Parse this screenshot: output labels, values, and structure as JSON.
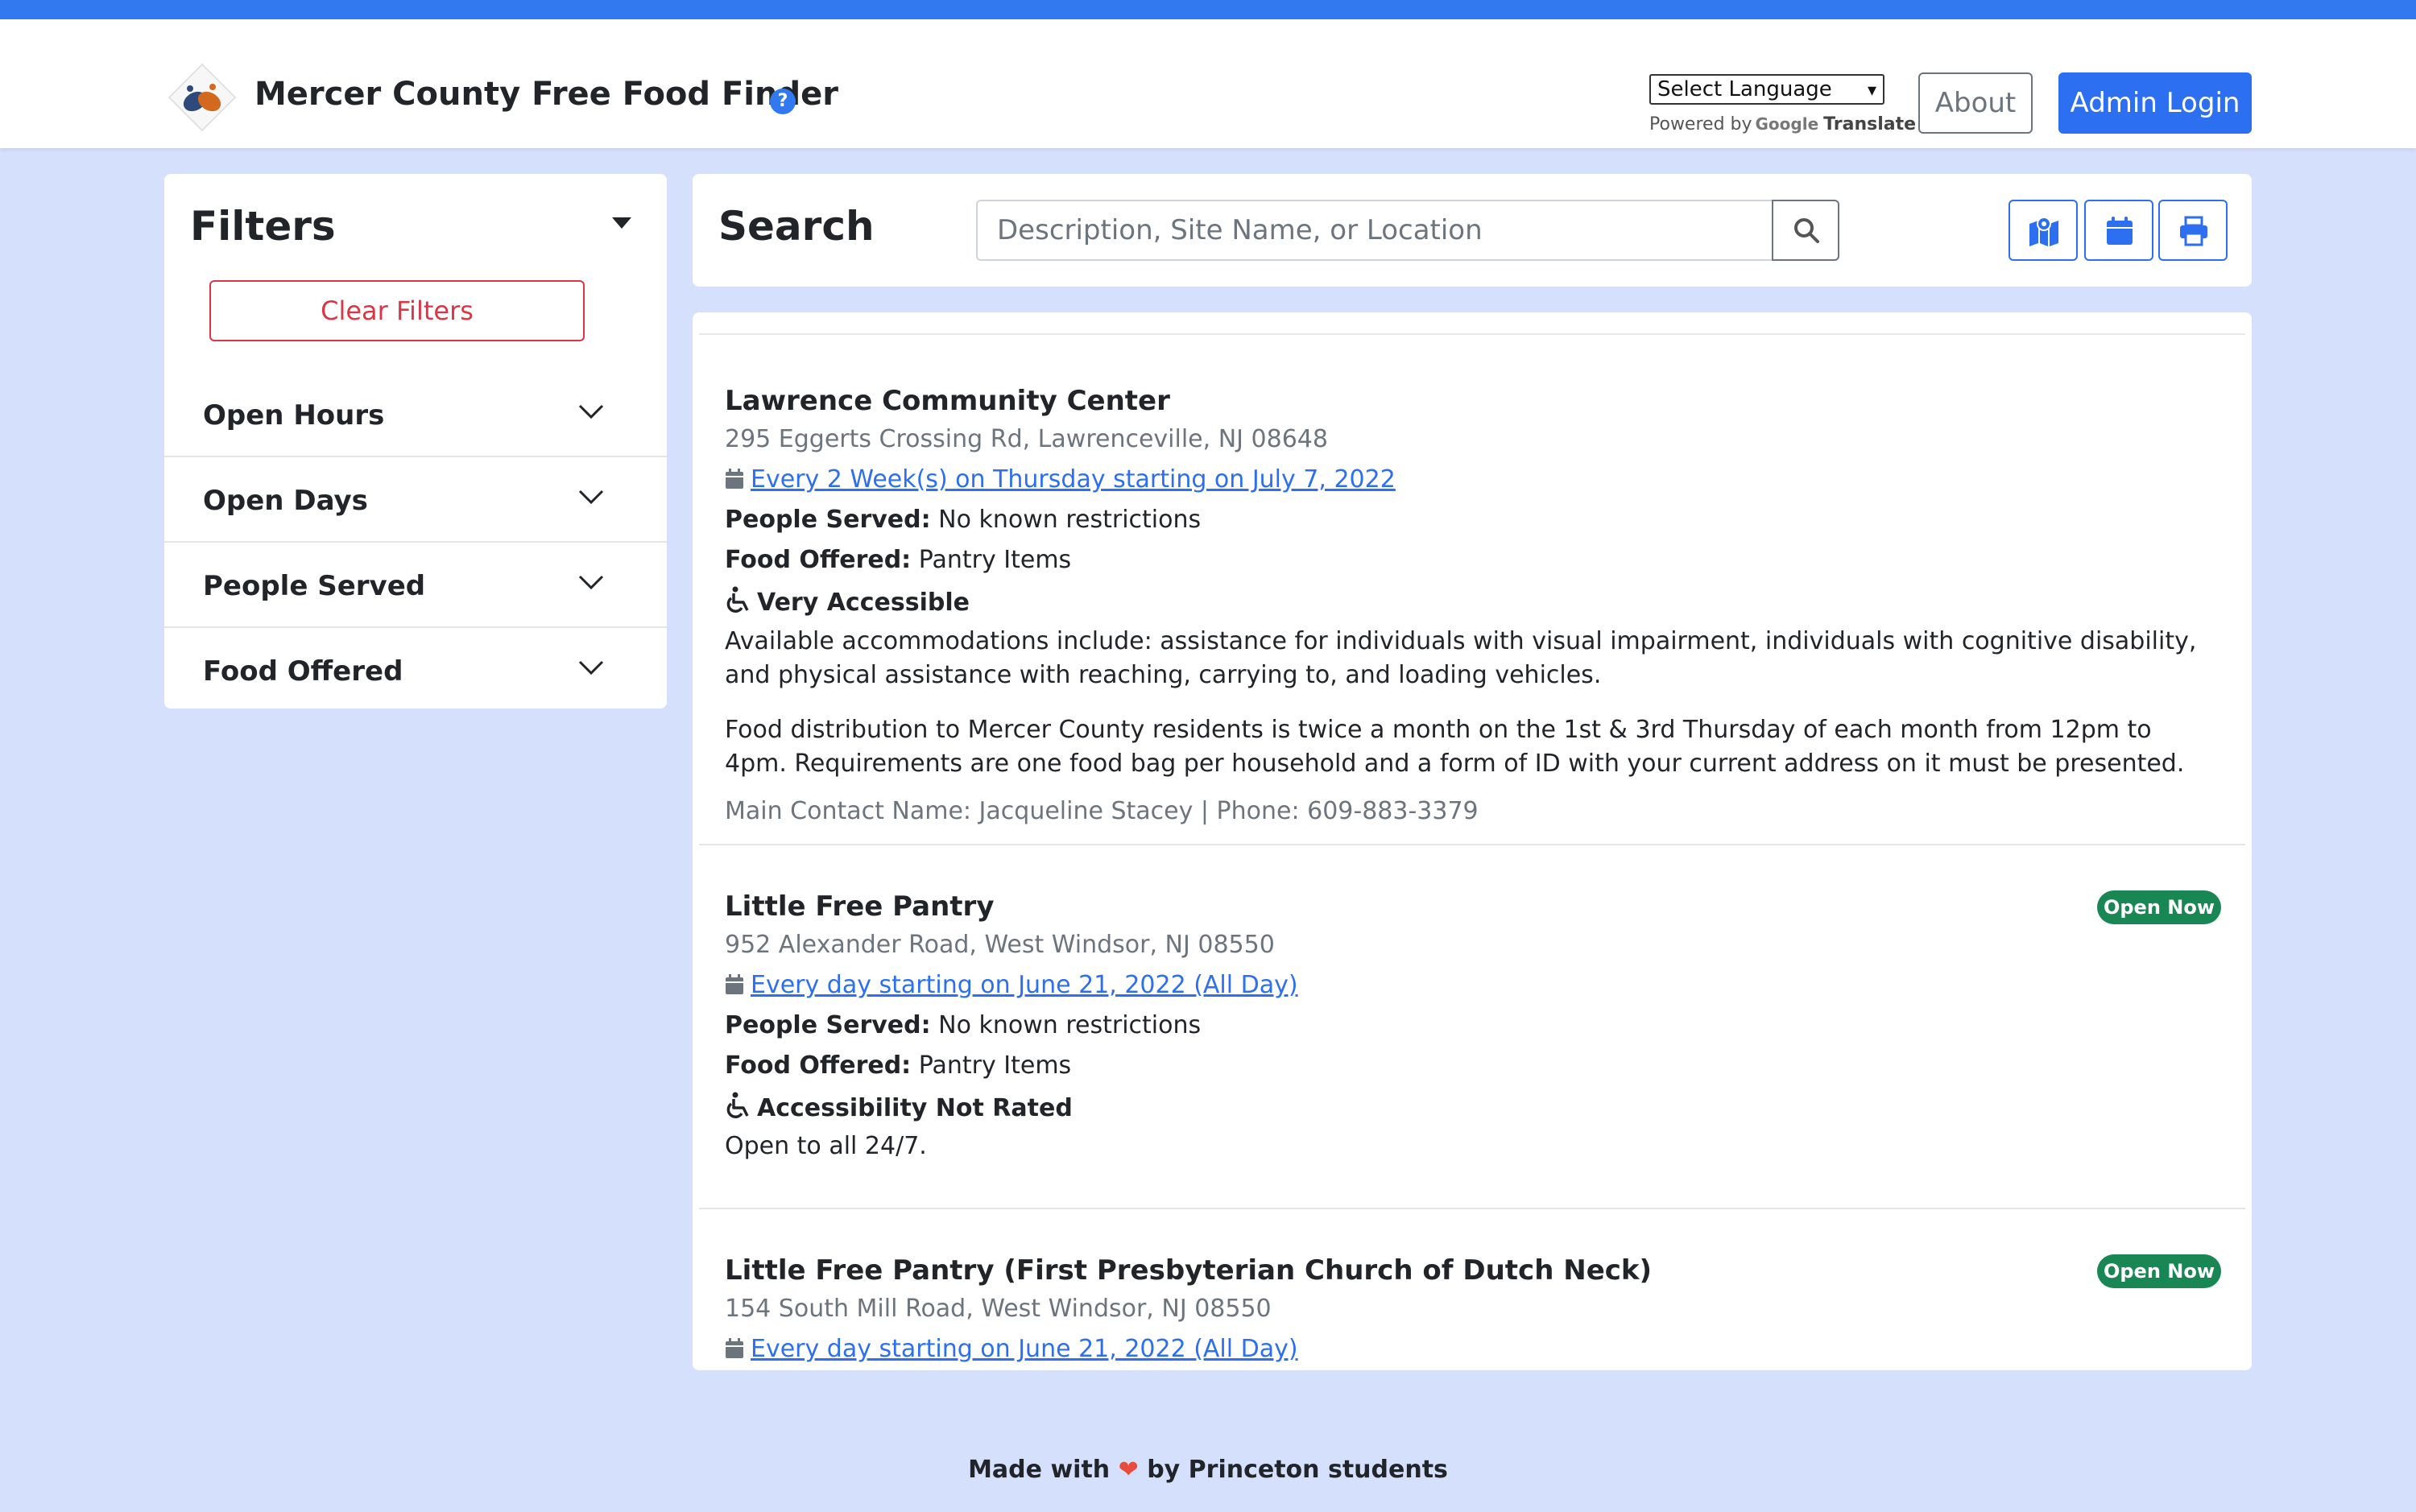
{
  "header": {
    "app_title": "Mercer County Free Food Finder",
    "help_icon": "?",
    "language_select": "Select Language",
    "powered_by": "Powered by",
    "google": "Google",
    "translate": "Translate",
    "about_label": "About",
    "admin_login_label": "Admin Login"
  },
  "filters": {
    "title": "Filters",
    "clear_label": "Clear Filters",
    "items": [
      {
        "label": "Open Hours"
      },
      {
        "label": "Open Days"
      },
      {
        "label": "People Served"
      },
      {
        "label": "Food Offered"
      }
    ]
  },
  "search": {
    "title": "Search",
    "placeholder": "Description, Site Name, or Location",
    "icons": [
      "map-icon",
      "calendar-icon",
      "print-icon"
    ]
  },
  "results": [
    {
      "name": "Lawrence Community Center",
      "address": "295 Eggerts Crossing Rd, Lawrenceville, NJ 08648",
      "schedule": "Every 2 Week(s) on Thursday starting on July 7, 2022",
      "people_label": "People Served:",
      "people_value": "No known restrictions",
      "food_label": "Food Offered:",
      "food_value": "Pantry Items",
      "accessibility": "Very Accessible",
      "accommodations": "Available accommodations include: assistance for individuals with visual impairment, individuals with cognitive disability, and physical assistance with reaching, carrying to, and loading vehicles.",
      "description": "Food distribution to Mercer County residents is twice a month on the 1st & 3rd Thursday of each month from 12pm to 4pm. Requirements are one food bag per household and a form of ID with your current address on it must be presented.",
      "contact": "Main Contact Name: Jacqueline Stacey | Phone: 609-883-3379"
    },
    {
      "name": "Little Free Pantry",
      "badge": "Open Now",
      "address": "952 Alexander Road, West Windsor, NJ 08550",
      "schedule": "Every day starting on June 21, 2022 (All Day)",
      "people_label": "People Served:",
      "people_value": "No known restrictions",
      "food_label": "Food Offered:",
      "food_value": "Pantry Items",
      "accessibility": "Accessibility Not Rated",
      "description": "Open to all 24/7."
    },
    {
      "name": "Little Free Pantry (First Presbyterian Church of Dutch Neck)",
      "badge": "Open Now",
      "address": "154 South Mill Road, West Windsor, NJ 08550",
      "schedule": "Every day starting on June 21, 2022 (All Day)"
    }
  ],
  "footer": {
    "made_with": "Made with",
    "heart": "❤",
    "by": "by Princeton students"
  },
  "colors": {
    "accent": "#3279f0",
    "background": "#d5e0fd",
    "danger": "#dc3545",
    "success": "#198754"
  }
}
